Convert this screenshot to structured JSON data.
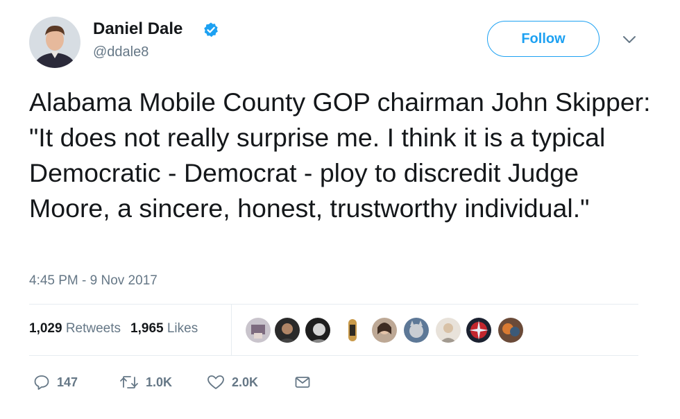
{
  "user": {
    "name": "Daniel Dale",
    "handle": "@ddale8"
  },
  "follow_label": "Follow",
  "tweet": {
    "text": "Alabama Mobile County GOP chairman John Skipper: \"It does not really surprise me. I think it is a typical Democratic - Democrat - ploy to discredit Judge Moore, a sincere, honest, trustworthy individual.\"",
    "timestamp": "4:45 PM - 9 Nov 2017"
  },
  "stats": {
    "retweets_count": "1,029",
    "retweets_label": "Retweets",
    "likes_count": "1,965",
    "likes_label": "Likes"
  },
  "actions": {
    "reply_count": "147",
    "retweet_count": "1.0K",
    "like_count": "2.0K"
  },
  "icons": [
    "verified-badge-icon",
    "chevron-down-icon",
    "reply-icon",
    "retweet-icon",
    "heart-icon",
    "direct-message-icon"
  ],
  "colors": {
    "accent": "#1da1f2",
    "text": "#14171a",
    "secondary_text": "#657786",
    "divider": "#e6ecf0"
  }
}
